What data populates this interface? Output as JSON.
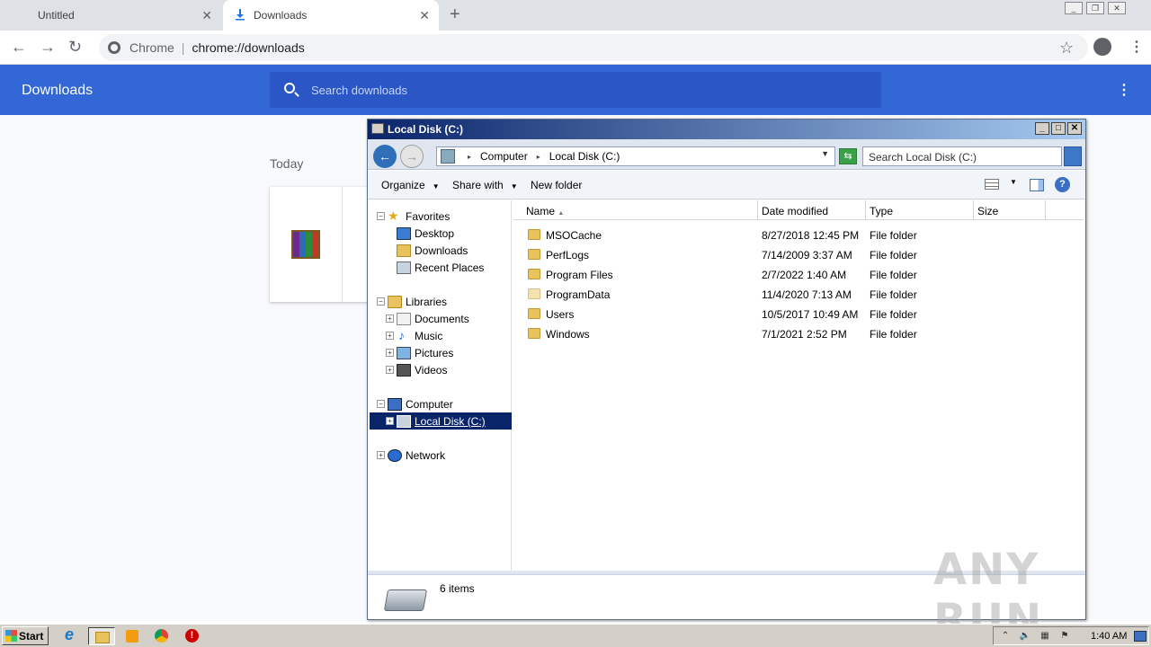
{
  "browser": {
    "tabs": [
      {
        "label": "Untitled",
        "close": "✕"
      },
      {
        "label": "Downloads",
        "close": "✕"
      }
    ],
    "new_tab": "+",
    "nav": {
      "back": "←",
      "forward": "→",
      "reload": "↻"
    },
    "omnibox": {
      "site": "Chrome",
      "url": "chrome://downloads"
    },
    "star": "☆",
    "menu": "⋮"
  },
  "downloads_page": {
    "title": "Downloads",
    "search_placeholder": "Search downloads",
    "menu": "⋮",
    "section_today": "Today"
  },
  "explorer": {
    "title": "Local Disk (C:)",
    "controls": {
      "minimize": "_",
      "maximize": "□",
      "close": "✕"
    },
    "breadcrumb": [
      "Computer",
      "Local Disk (C:)"
    ],
    "search_placeholder": "Search Local Disk (C:)",
    "commands": {
      "organize": "Organize",
      "share_with": "Share with",
      "new_folder": "New folder"
    },
    "help": "?",
    "nav": {
      "favorites": "Favorites",
      "desktop": "Desktop",
      "downloads": "Downloads",
      "recent_places": "Recent Places",
      "libraries": "Libraries",
      "documents": "Documents",
      "music": "Music",
      "pictures": "Pictures",
      "videos": "Videos",
      "computer": "Computer",
      "local_disk": "Local Disk (C:)",
      "network": "Network"
    },
    "columns": {
      "name": "Name",
      "date_modified": "Date modified",
      "type": "Type",
      "size": "Size"
    },
    "files": [
      {
        "name": "MSOCache",
        "date": "8/27/2018 12:45 PM",
        "type": "File folder"
      },
      {
        "name": "PerfLogs",
        "date": "7/14/2009 3:37 AM",
        "type": "File folder"
      },
      {
        "name": "Program Files",
        "date": "2/7/2022 1:40 AM",
        "type": "File folder"
      },
      {
        "name": "ProgramData",
        "date": "11/4/2020 7:13 AM",
        "type": "File folder"
      },
      {
        "name": "Users",
        "date": "10/5/2017 10:49 AM",
        "type": "File folder"
      },
      {
        "name": "Windows",
        "date": "7/1/2021 2:52 PM",
        "type": "File folder"
      }
    ],
    "status": "6 items"
  },
  "taskbar": {
    "start": "Start",
    "clock": "1:40 AM"
  },
  "watermark": "ANY RUN"
}
